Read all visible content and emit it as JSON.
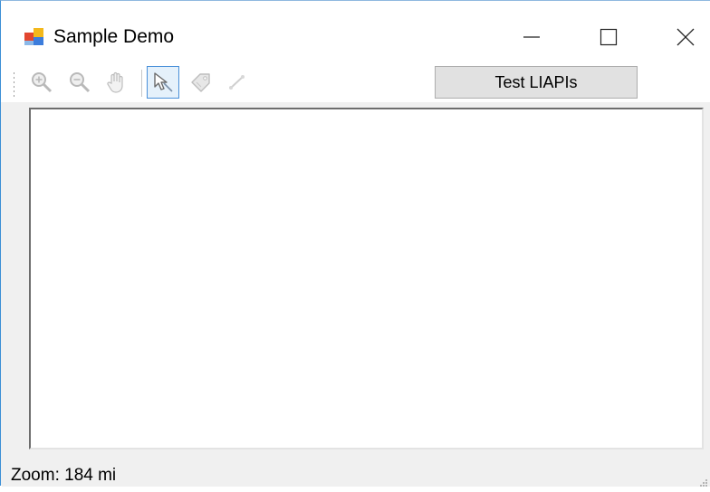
{
  "window": {
    "title": "Sample Demo",
    "minimize_icon": "minimize-icon",
    "maximize_icon": "maximize-icon",
    "close_icon": "close-icon"
  },
  "toolbar": {
    "tools": [
      {
        "name": "zoom-in",
        "icon": "zoom-in-icon",
        "active": false,
        "enabled": false
      },
      {
        "name": "zoom-out",
        "icon": "zoom-out-icon",
        "active": false,
        "enabled": false
      },
      {
        "name": "pan",
        "icon": "hand-icon",
        "active": false,
        "enabled": false
      },
      {
        "name": "select",
        "icon": "pointer-icon",
        "active": true,
        "enabled": true
      },
      {
        "name": "tag",
        "icon": "tag-icon",
        "active": false,
        "enabled": false
      },
      {
        "name": "measure",
        "icon": "measure-icon",
        "active": false,
        "enabled": false
      }
    ],
    "test_button_label": "Test LIAPIs"
  },
  "status": {
    "zoom_text": "Zoom: 184 mi"
  },
  "colors": {
    "accent": "#4a90d9",
    "window_border": "#3c8fd6",
    "panel_bg": "#ffffff",
    "chrome_bg": "#f0f0f0"
  }
}
